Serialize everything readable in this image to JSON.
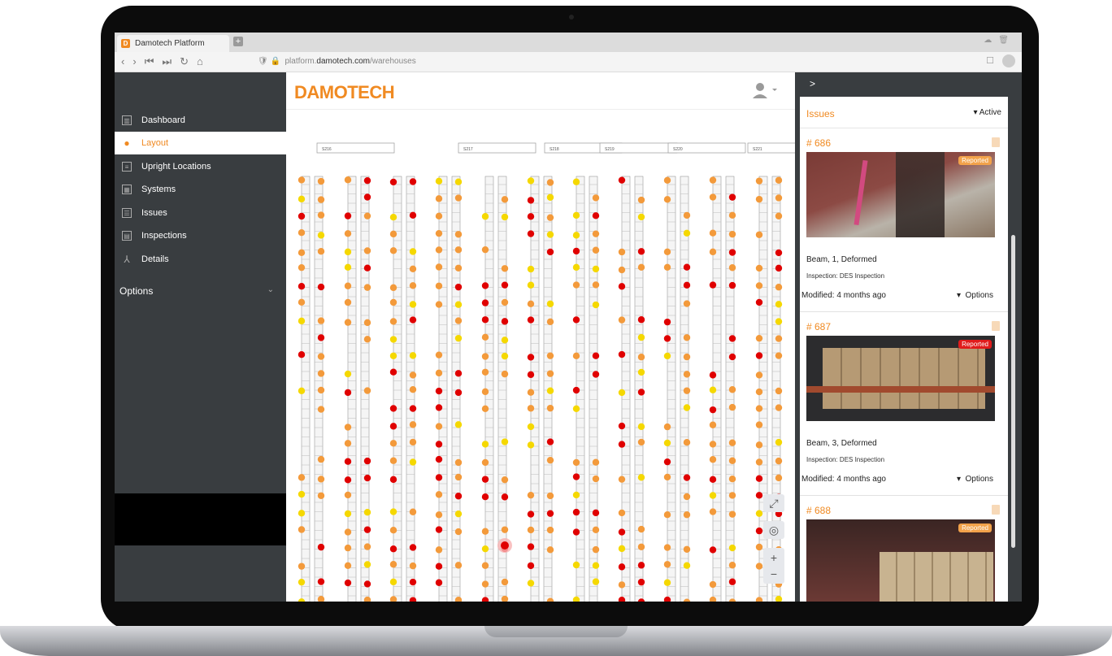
{
  "browser": {
    "tab_title": "Damotech Platform",
    "tab_logo": "D",
    "url_prefix": "platform.",
    "url_domain": "damotech.com",
    "url_path": "/warehouses",
    "nav_icons": [
      "back-icon",
      "forward-icon",
      "first-icon",
      "last-icon",
      "reload-icon",
      "home-icon"
    ]
  },
  "sidebar": {
    "items": [
      {
        "label": "Dashboard",
        "icon": "chart-icon"
      },
      {
        "label": "Layout",
        "icon": "pin-icon",
        "active": true
      },
      {
        "label": "Upright Locations",
        "icon": "grid-icon"
      },
      {
        "label": "Systems",
        "icon": "blocks-icon"
      },
      {
        "label": "Issues",
        "icon": "list-icon"
      },
      {
        "label": "Inspections",
        "icon": "clipboard-icon"
      },
      {
        "label": "Details",
        "icon": "network-icon"
      }
    ],
    "options_label": "Options"
  },
  "main": {
    "logo": "DAMOTECH",
    "bay_labels": [
      "S216",
      "S217",
      "S218",
      "S219",
      "S220",
      "S221"
    ],
    "controls": [
      "fullscreen-icon",
      "locate-icon",
      "zoom-in-icon",
      "zoom-out-icon"
    ]
  },
  "panel": {
    "toggle": ">",
    "issues_title": "Issues",
    "filter": "Active",
    "cards": [
      {
        "id": "# 686",
        "badge": "Reported",
        "badge_color": "#f2a24a",
        "title": "Beam, 1, Deformed",
        "inspection": "Inspection: DES Inspection",
        "modified": "Modified: 4 months ago",
        "options": "Options"
      },
      {
        "id": "# 687",
        "badge": "Reported",
        "badge_color": "#e01b1b",
        "title": "Beam, 3, Deformed",
        "inspection": "Inspection: DES Inspection",
        "modified": "Modified: 4 months ago",
        "options": "Options"
      },
      {
        "id": "# 688",
        "badge": "Reported",
        "badge_color": "#f2a24a",
        "title": "",
        "inspection": "",
        "modified": "",
        "options": ""
      }
    ]
  },
  "colors": {
    "accent": "#f08a22",
    "sidebar": "#393d40",
    "marker_red": "#e00000",
    "marker_orange": "#f39a3b",
    "marker_yellow": "#f5d800"
  }
}
